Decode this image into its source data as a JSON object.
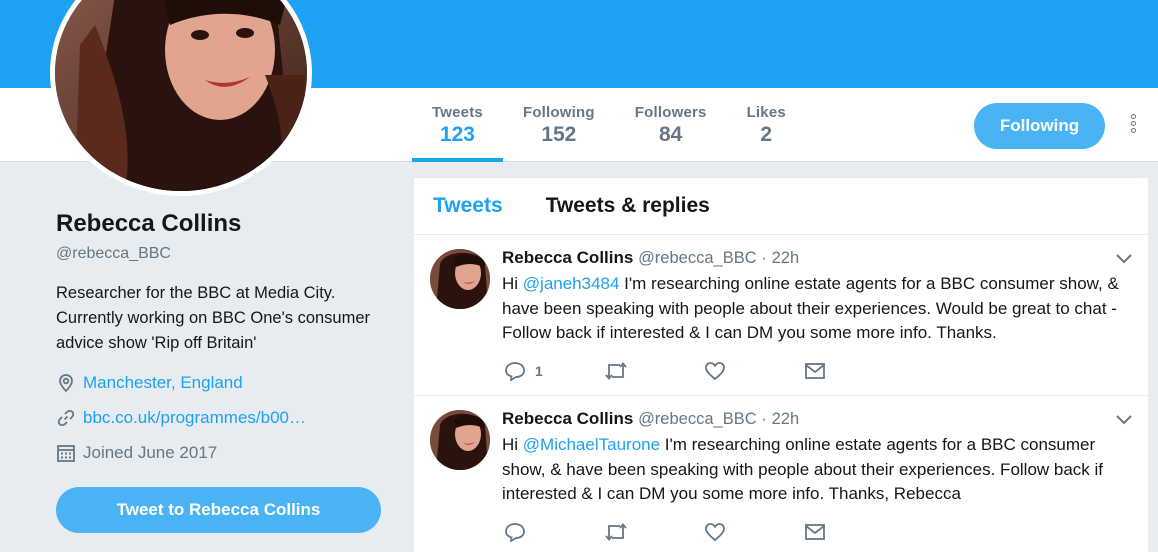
{
  "colors": {
    "brand": "#1da1f2",
    "button": "#4ab3f4",
    "muted": "#657786",
    "background": "#e6ecf0"
  },
  "stats": [
    {
      "label": "Tweets",
      "value": "123"
    },
    {
      "label": "Following",
      "value": "152"
    },
    {
      "label": "Followers",
      "value": "84"
    },
    {
      "label": "Likes",
      "value": "2"
    }
  ],
  "follow_button": "Following",
  "more_icon": "vertical-dots-icon",
  "profile": {
    "name": "Rebecca Collins",
    "handle": "@rebecca_BBC",
    "bio": "Researcher for the BBC at Media City. Currently working on BBC One's consumer advice show 'Rip off Britain'",
    "location": "Manchester, England",
    "website": "bbc.co.uk/programmes/b00…",
    "joined": "Joined June 2017",
    "tweet_to_button": "Tweet to Rebecca Collins"
  },
  "tabs": [
    "Tweets",
    "Tweets & replies"
  ],
  "tweets": [
    {
      "name": "Rebecca Collins",
      "handle": "@rebecca_BBC",
      "sep": "·",
      "time": "22h",
      "text_pre": "Hi ",
      "mention": "@janeh3484",
      "text_post": " I'm researching online estate agents for a BBC consumer show, & have been speaking with people about their experiences. Would be great to chat - Follow back if interested & I can DM you some more info. Thanks.",
      "reply_count": "1"
    },
    {
      "name": "Rebecca Collins",
      "handle": "@rebecca_BBC",
      "sep": "·",
      "time": "22h",
      "text_pre": "Hi ",
      "mention": "@MichaelTaurone",
      "text_post": " I'm researching online estate agents for a BBC consumer show, & have been speaking with people about their experiences. Follow back if interested & I can DM you some more info. Thanks, Rebecca",
      "reply_count": ""
    }
  ]
}
